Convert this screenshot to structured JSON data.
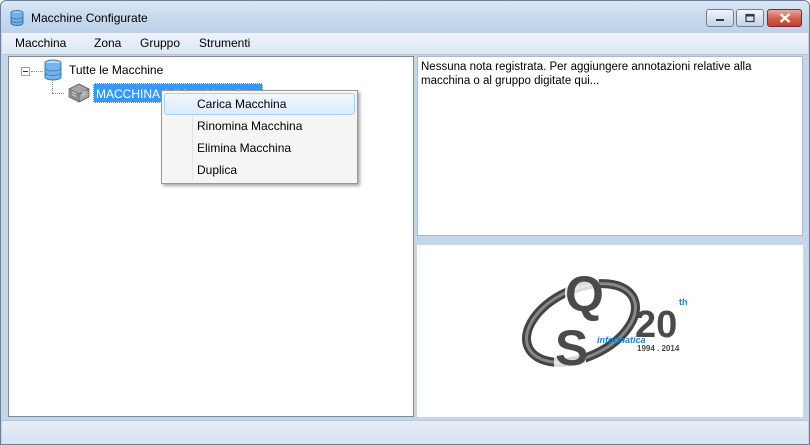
{
  "window": {
    "title": "Macchine Configurate",
    "controls": {
      "minimize": "minimize-icon",
      "maximize": "maximize-icon",
      "close": "close-icon"
    }
  },
  "menubar": {
    "items": [
      "Macchina",
      "Zona",
      "Gruppo",
      "Strumenti"
    ]
  },
  "tree": {
    "root_label": "Tutte le Macchine",
    "root_icon": "database-icon",
    "child_label": "MACCHINA 1 (Macchina di prova)",
    "child_icon": "machine-icon"
  },
  "context_menu": {
    "items": [
      "Carica Macchina",
      "Rinomina Macchina",
      "Elimina Macchina",
      "Duplica"
    ],
    "highlighted_index": 0
  },
  "notes": {
    "text": "Nessuna nota registrata. Per aggiungere annotazioni relative alla macchina o al gruppo digitate qui..."
  },
  "logo": {
    "letters_q": "Q",
    "letters_s": "S",
    "brand": "informatica",
    "anniversary": "20",
    "suffix": "th",
    "years": "1994 . 2014"
  },
  "colors": {
    "selection": "#3399ff",
    "logo_blue": "#1f7fc4",
    "logo_gray": "#4a4a4a",
    "chrome": "#c4d6ea"
  }
}
